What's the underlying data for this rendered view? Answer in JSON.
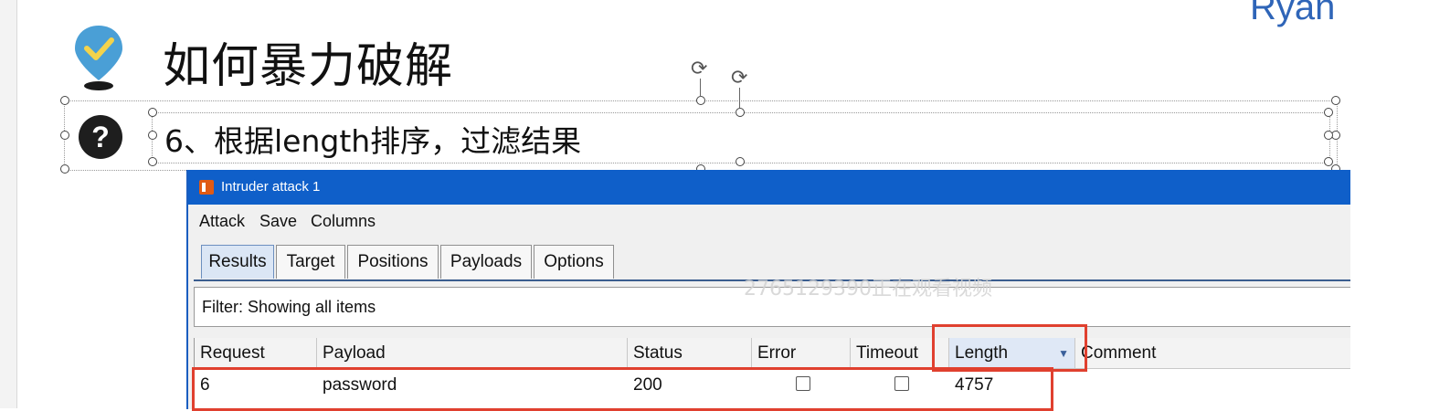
{
  "slide": {
    "brand": "Ryan",
    "title": "如何暴力破解",
    "subtitle": "6、根据length排序，过滤结果",
    "question_glyph": "?",
    "watermark": "2765129390正在观看视频"
  },
  "window": {
    "title": "Intruder attack 1",
    "menu": [
      "Attack",
      "Save",
      "Columns"
    ],
    "tabs": [
      "Results",
      "Target",
      "Positions",
      "Payloads",
      "Options"
    ],
    "active_tab": "Results",
    "filter": "Filter: Showing all items",
    "columns": [
      "Request",
      "Payload",
      "Status",
      "Error",
      "Timeout",
      "Length",
      "Comment"
    ],
    "sorted_column": "Length",
    "rows": [
      {
        "request": "6",
        "payload": "password",
        "status": "200",
        "error": false,
        "timeout": false,
        "length": "4757",
        "comment": ""
      }
    ]
  },
  "colors": {
    "titlebar": "#0f5fc9",
    "highlight": "#e0402f",
    "brand": "#2f65b8"
  },
  "icons": {
    "pin": "location-check-icon",
    "question": "question-circle-icon",
    "rotate": "rotate-handle-icon",
    "sort": "sort-down-icon",
    "app": "burp-icon"
  }
}
